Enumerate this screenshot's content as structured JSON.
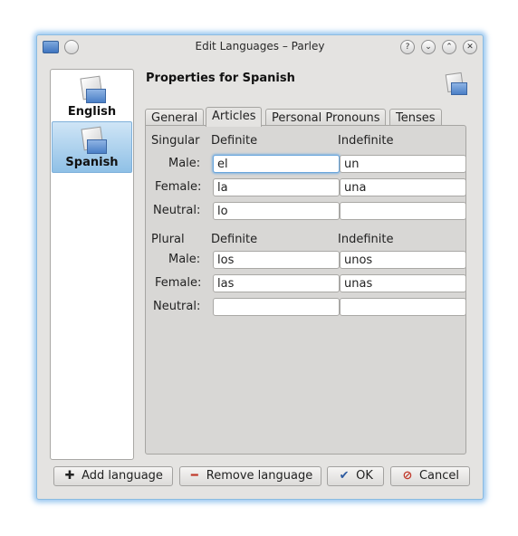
{
  "window": {
    "title": "Edit Languages – Parley"
  },
  "titlebar_buttons": [
    "?",
    "⌄",
    "⌃",
    "✕"
  ],
  "sidebar": {
    "items": [
      {
        "label": "English",
        "selected": false
      },
      {
        "label": "Spanish",
        "selected": true
      }
    ]
  },
  "header": {
    "title": "Properties for Spanish"
  },
  "tabs": [
    "General",
    "Articles",
    "Personal Pronouns",
    "Tenses"
  ],
  "active_tab": "Articles",
  "articles": {
    "singular": {
      "section_label": "Singular",
      "definite_header": "Definite",
      "indefinite_header": "Indefinite",
      "rows": [
        {
          "label": "Male:",
          "definite": "el",
          "indefinite": "un"
        },
        {
          "label": "Female:",
          "definite": "la",
          "indefinite": "una"
        },
        {
          "label": "Neutral:",
          "definite": "lo",
          "indefinite": ""
        }
      ]
    },
    "plural": {
      "section_label": "Plural",
      "definite_header": "Definite",
      "indefinite_header": "Indefinite",
      "rows": [
        {
          "label": "Male:",
          "definite": "los",
          "indefinite": "unos"
        },
        {
          "label": "Female:",
          "definite": "las",
          "indefinite": "unas"
        },
        {
          "label": "Neutral:",
          "definite": "",
          "indefinite": ""
        }
      ]
    }
  },
  "buttons": {
    "add_language": "Add language",
    "remove_language": "Remove language",
    "ok": "OK",
    "cancel": "Cancel"
  },
  "colors": {
    "accent": "#8fc0e6",
    "window_bg": "#e4e3e1",
    "glow": "#78b4eb"
  }
}
